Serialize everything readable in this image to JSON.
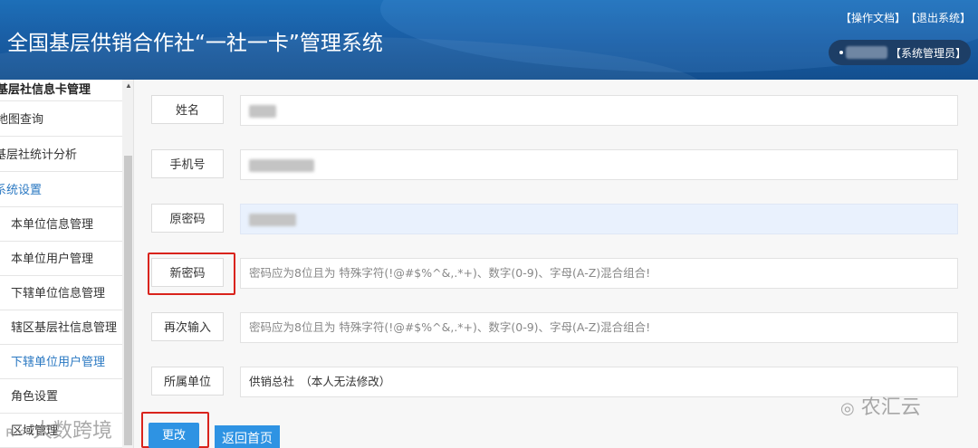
{
  "header": {
    "app_title": "全国基层供销合作社“一社一卡”管理系统",
    "links": [
      "【操作文档】",
      "【退出系统】"
    ],
    "user_role": "【系统管理员】"
  },
  "sidebar": {
    "items": [
      {
        "label": "基层社信息卡管理",
        "kind": "head"
      },
      {
        "label": "地图查询",
        "kind": "item"
      },
      {
        "label": "基层社统计分析",
        "kind": "item"
      },
      {
        "label": "系统设置",
        "kind": "active"
      },
      {
        "label": "本单位信息管理",
        "kind": "sub"
      },
      {
        "label": "本单位用户管理",
        "kind": "sub"
      },
      {
        "label": "下辖单位信息管理",
        "kind": "sub"
      },
      {
        "label": "辖区基层社信息管理",
        "kind": "sub"
      },
      {
        "label": "下辖单位用户管理",
        "kind": "sub"
      },
      {
        "label": "角色设置",
        "kind": "sub"
      },
      {
        "label": "区域管理",
        "kind": "sub"
      }
    ]
  },
  "form": {
    "name_label": "姓名",
    "phone_label": "手机号",
    "old_password_label": "原密码",
    "new_password_label": "新密码",
    "new_password_placeholder": "密码应为8位且为 特殊字符(!@#$%^&,.*+)、数字(0-9)、字母(A-Z)混合组合!",
    "confirm_label": "再次输入",
    "confirm_placeholder": "密码应为8位且为 特殊字符(!@#$%^&,.*+)、数字(0-9)、字母(A-Z)混合组合!",
    "unit_label": "所属单位",
    "unit_value": "供销总社　（本人无法修改）"
  },
  "buttons": {
    "update": "更改",
    "back_home": "返回首页"
  },
  "watermarks": {
    "left": "大数跨境",
    "right": "农汇云"
  },
  "colors": {
    "header_blue": "#1a5fa6",
    "button_blue": "#2e93e3",
    "highlight_red": "#d9231c"
  }
}
